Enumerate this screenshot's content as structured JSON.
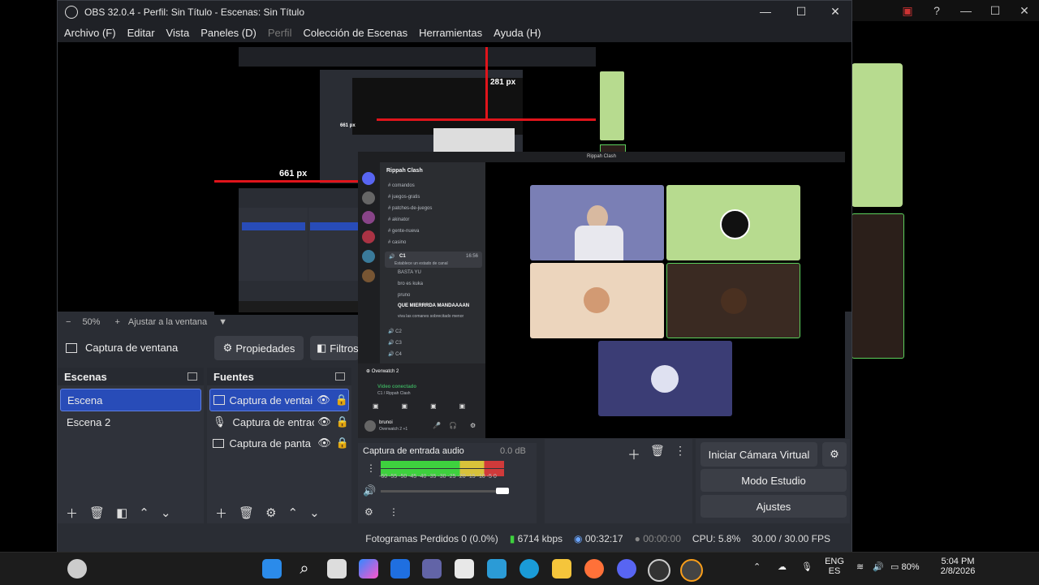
{
  "obs": {
    "title": "OBS 32.0.4 - Perfil: Sin Título - Escenas: Sin Título",
    "menu": [
      "Archivo (F)",
      "Editar",
      "Vista",
      "Paneles (D)",
      "Perfil",
      "Colección de Escenas",
      "Herramientas",
      "Ayuda (H)"
    ],
    "zoom": {
      "minus": "−",
      "value": "50%",
      "plus": "+",
      "fit_label": "Ajustar a la ventana"
    },
    "source_toolbar": {
      "current_source": "Captura de ventana",
      "properties": "Propiedades",
      "filters": "Filtros"
    },
    "scenes": {
      "title": "Escenas",
      "items": [
        "Escena",
        "Escena 2"
      ]
    },
    "sources": {
      "title": "Fuentes",
      "items": [
        "Captura de ventai",
        "Captura de entrac",
        "Captura de panta"
      ]
    },
    "audio": {
      "name": "Captura de entrada audio",
      "level": "0.0 dB",
      "scale": "-60 -55 -50 -45 -40 -35 -30 -25 -20 -15 -10 -5 0"
    },
    "controls": {
      "virtual_cam": "Iniciar Cámara Virtual",
      "studio": "Modo Estudio",
      "settings": "Ajustes"
    },
    "status": {
      "dropped": "Fotogramas Perdidos 0 (0.0%)",
      "bitrate": "6714 kbps",
      "time": "00:32:17",
      "rec": "00:00:00",
      "cpu": "CPU: 5.8%",
      "fps": "30.00 / 30.00 FPS"
    },
    "preview_labels": {
      "px1": "661 px",
      "px2": "281 px",
      "px3": "661 px"
    }
  },
  "discord": {
    "title": "Rippah Clash",
    "server": "Rippah Clash",
    "channels": [
      "comandos",
      "juegos-gratis",
      "patches-de-juegos",
      "akinator",
      "gente-nueva",
      "casino"
    ],
    "voice_channel": "C1",
    "voice_time": "16:56",
    "status_placeholder": "Establece un estado de canal",
    "voice_users": [
      "BASTA YU",
      "bro es kuka",
      "pruno",
      "QUE MIERRRDA MANDAAAAN",
      "viva las comanes sobrecitado menor"
    ],
    "other_voice": [
      "C2",
      "C3",
      "C4"
    ],
    "activity": "Overwatch 2",
    "connected": "Vídeo conectado",
    "connected_sub": "C1 / Rippah Clash",
    "user": "brunoi",
    "user_status": "Overwatch 2 +1"
  },
  "taskbar": {
    "lang1": "ENG",
    "lang2": "ES",
    "battery": "80%",
    "time": "5:04 PM",
    "date": "2/8/2026"
  }
}
